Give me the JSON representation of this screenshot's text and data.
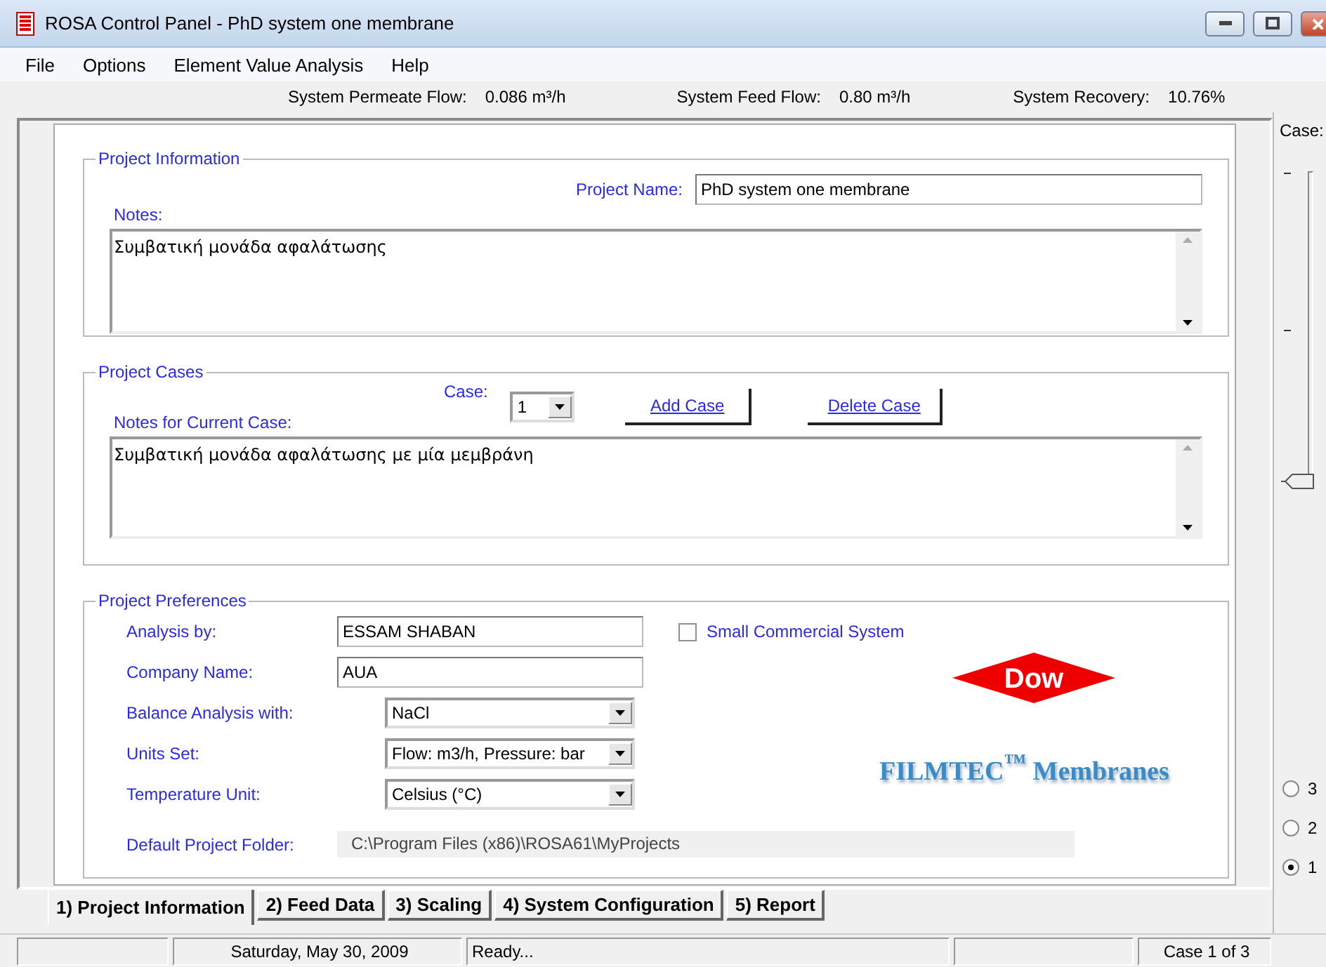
{
  "window": {
    "title": "ROSA Control Panel - PhD system one membrane"
  },
  "menu": [
    "File",
    "Options",
    "Element Value Analysis",
    "Help"
  ],
  "summary": [
    {
      "label": "System Permeate Flow:",
      "value": "0.086 m³/h"
    },
    {
      "label": "System Feed Flow:",
      "value": "0.80 m³/h"
    },
    {
      "label": "System Recovery:",
      "value": "10.76%"
    }
  ],
  "project_information": {
    "title": "Project Information",
    "project_name_label": "Project Name:",
    "project_name": "PhD system one membrane",
    "notes_label": "Notes:",
    "notes": "Συμβατική μονάδα αφαλάτωσης"
  },
  "project_cases": {
    "title": "Project Cases",
    "case_label": "Case:",
    "case_value": "1",
    "add_button": "Add Case",
    "delete_button": "Delete Case",
    "notes_label": "Notes for Current Case:",
    "notes": "Συμβατική μονάδα αφαλάτωσης με μία μεμβράνη"
  },
  "project_preferences": {
    "title": "Project Preferences",
    "fields": [
      {
        "label": "Analysis by:",
        "value": "ESSAM SHABAN",
        "kind": "text"
      },
      {
        "label": "Company Name:",
        "value": "AUA",
        "kind": "text"
      },
      {
        "label": "Balance Analysis with:",
        "value": "NaCl",
        "kind": "select"
      },
      {
        "label": "Units Set:",
        "value": "Flow: m3/h, Pressure: bar",
        "kind": "select"
      },
      {
        "label": "Temperature Unit:",
        "value": "Celsius (°C)",
        "kind": "select"
      },
      {
        "label": "Default Project Folder:",
        "value": "C:\\Program Files (x86)\\ROSA61\\MyProjects",
        "kind": "readonly"
      }
    ],
    "small_commercial": {
      "label": "Small Commercial System",
      "checked": false
    },
    "dow_logo": "Dow",
    "filmtec_logo": "FILMTEC$^{™}$ Membranes"
  },
  "case_panel": {
    "label": "Case:",
    "slider": {
      "level": 0
    },
    "radios": [
      {
        "label": "3",
        "selected": false
      },
      {
        "label": "2",
        "selected": false
      },
      {
        "label": "1",
        "selected": true
      }
    ]
  },
  "tabs": [
    {
      "label": "1) Project Information",
      "selected": true
    },
    {
      "label": "2) Feed Data",
      "selected": false
    },
    {
      "label": "3) Scaling",
      "selected": false
    },
    {
      "label": "4) System Configuration",
      "selected": false
    },
    {
      "label": "5) Report",
      "selected": false
    }
  ],
  "status_bar": {
    "date": "Saturday, May 30, 2009",
    "message": "Ready...",
    "case": "Case 1 of 3"
  }
}
